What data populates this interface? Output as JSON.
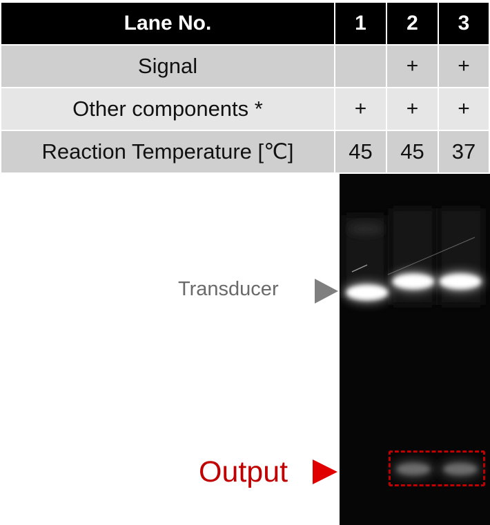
{
  "table": {
    "header": {
      "label": "Lane No.",
      "lanes": [
        "1",
        "2",
        "3"
      ]
    },
    "rows": [
      {
        "label": "Signal",
        "values": [
          "",
          "+",
          "+"
        ]
      },
      {
        "label": "Other components *",
        "values": [
          "+",
          "+",
          "+"
        ]
      },
      {
        "label": "Reaction Temperature [℃]",
        "values": [
          "45",
          "45",
          "37"
        ]
      }
    ]
  },
  "gel": {
    "lanes": [
      {
        "transducer_band": true,
        "output_band": false
      },
      {
        "transducer_band": true,
        "output_band": true
      },
      {
        "transducer_band": true,
        "output_band": true
      }
    ]
  },
  "labels": {
    "transducer": "Transducer",
    "output": "Output"
  },
  "colors": {
    "header_bg": "#000000",
    "row_dark": "#cfcfcf",
    "row_light": "#e6e6e6",
    "output_accent": "#c00000",
    "transducer_arrow": "#7f7f7f"
  }
}
